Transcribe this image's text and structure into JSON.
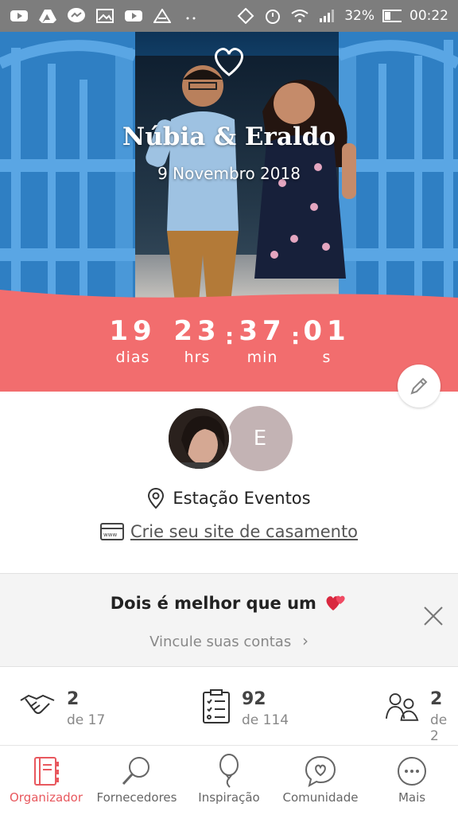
{
  "status_bar": {
    "icons": [
      "youtube-icon",
      "drive-icon",
      "messenger-icon",
      "gallery-icon",
      "youtube-icon",
      "app-icon",
      "more-icon",
      "vibrate-icon",
      "alarm-icon",
      "wifi-icon",
      "signal-icon"
    ],
    "battery": "32%",
    "time": "00:22"
  },
  "hero": {
    "title": "Núbia & Eraldo",
    "date": "9 Novembro 2018"
  },
  "countdown": {
    "days": "19",
    "days_label": "dias",
    "hours": "23",
    "hours_label": "hrs",
    "minutes": "37",
    "minutes_label": "min",
    "seconds": "01",
    "seconds_label": "s",
    "separator": ":"
  },
  "profile": {
    "partner2_initial": "E",
    "venue": "Estação Eventos",
    "website_link": "Crie seu site de casamento"
  },
  "promo": {
    "title": "Dois é melhor que um",
    "subtitle": "Vincule suas contas",
    "chevron": "›"
  },
  "stats": [
    {
      "icon": "handshake-icon",
      "value": "2",
      "sub": "de 17"
    },
    {
      "icon": "checklist-icon",
      "value": "92",
      "sub": "de 114"
    },
    {
      "icon": "guests-icon",
      "value": "2",
      "sub": "de 2"
    }
  ],
  "nav": [
    {
      "label": "Organizador",
      "icon": "planner-icon",
      "active": true
    },
    {
      "label": "Fornecedores",
      "icon": "search-icon",
      "active": false
    },
    {
      "label": "Inspiração",
      "icon": "balloon-icon",
      "active": false
    },
    {
      "label": "Comunidade",
      "icon": "chat-heart-icon",
      "active": false
    },
    {
      "label": "Mais",
      "icon": "more-icon",
      "active": false
    }
  ],
  "colors": {
    "accent": "#f26d6e",
    "active_nav": "#e8585e",
    "status_bar": "#7d7d7d"
  }
}
